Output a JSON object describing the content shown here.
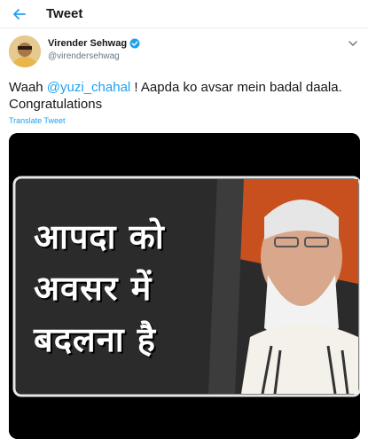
{
  "header": {
    "title": "Tweet",
    "back_icon": "arrow-left-icon"
  },
  "tweet": {
    "author_name": "Virender Sehwag",
    "author_handle": "@virendersehwag",
    "verified_icon": "verified-badge-icon",
    "text_prefix": "Waah ",
    "mention": "@yuzi_chahal",
    "text_suffix": " ! Aapda ko avsar mein badal daala. Congratulations",
    "translate_label": "Translate Tweet"
  },
  "media": {
    "overlay_lines": [
      "आपदा को",
      "अवसर में",
      "बदलना है"
    ]
  },
  "colors": {
    "accent": "#1da1f2",
    "text": "#14171a",
    "secondary": "#657786",
    "divider": "#e6ecf0"
  }
}
